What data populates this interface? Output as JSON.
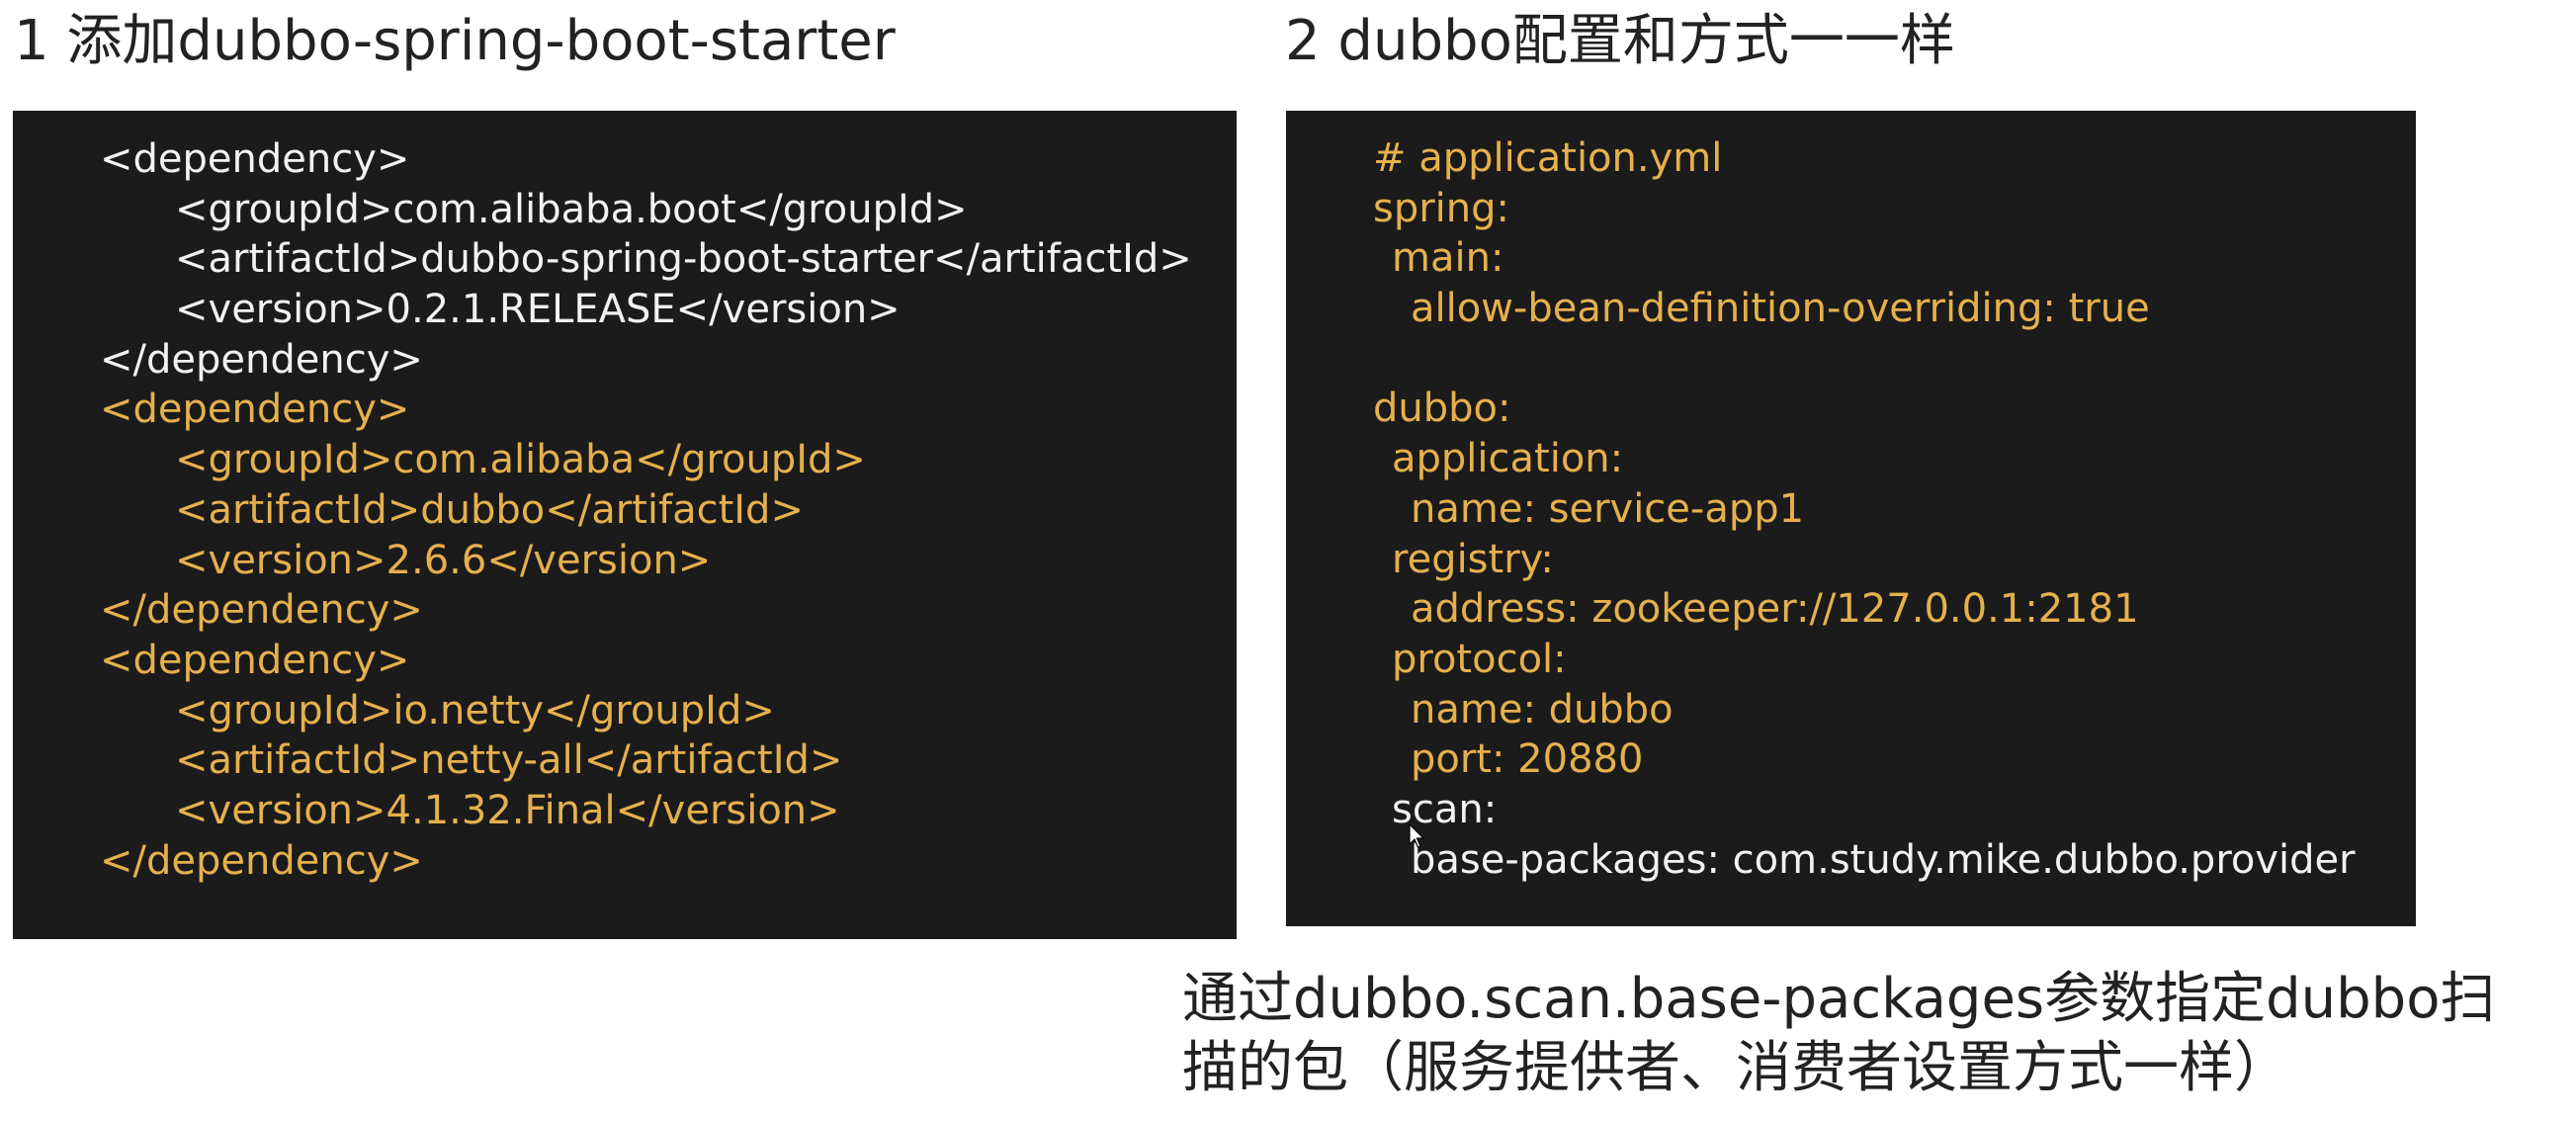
{
  "left_section": {
    "heading": "1 添加dubbo-spring-boot-starter",
    "code_lines": [
      {
        "text": "<dependency>",
        "indent": 0,
        "color": "#f2f2f2"
      },
      {
        "text": "<groupId>com.alibaba.boot</groupId>",
        "indent": 1,
        "color": "#f2f2f2"
      },
      {
        "text": "<artifactId>dubbo-spring-boot-starter</artifactId>",
        "indent": 1,
        "color": "#f2f2f2"
      },
      {
        "text": "<version>0.2.1.RELEASE</version>",
        "indent": 1,
        "color": "#f2f2f2"
      },
      {
        "text": "</dependency>",
        "indent": 0,
        "color": "#f2f2f2"
      },
      {
        "text": "<dependency>",
        "indent": 0,
        "color": "#e6b04d"
      },
      {
        "text": "<groupId>com.alibaba</groupId>",
        "indent": 1,
        "color": "#e6b04d"
      },
      {
        "text": "<artifactId>dubbo</artifactId>",
        "indent": 1,
        "color": "#e6b04d"
      },
      {
        "text": "<version>2.6.6</version>",
        "indent": 1,
        "color": "#e6b04d"
      },
      {
        "text": "</dependency>",
        "indent": 0,
        "color": "#e6b04d"
      },
      {
        "text": "<dependency>",
        "indent": 0,
        "color": "#e6b04d"
      },
      {
        "text": "<groupId>io.netty</groupId>",
        "indent": 1,
        "color": "#e6b04d"
      },
      {
        "text": "<artifactId>netty-all</artifactId>",
        "indent": 1,
        "color": "#e6b04d"
      },
      {
        "text": "<version>4.1.32.Final</version>",
        "indent": 1,
        "color": "#e6b04d"
      },
      {
        "text": "</dependency>",
        "indent": 0,
        "color": "#e6b04d"
      }
    ]
  },
  "right_section": {
    "heading": "2 dubbo配置和方式一一样",
    "code_lines": [
      {
        "text": "# application.yml",
        "indent": 0,
        "color": "#e6b04d"
      },
      {
        "text": "spring:",
        "indent": 0,
        "color": "#e6b04d"
      },
      {
        "text": "main:",
        "indent": 1,
        "color": "#e6b04d"
      },
      {
        "text": "allow-bean-definition-overriding: true",
        "indent": 2,
        "color": "#e6b04d"
      },
      {
        "text": "",
        "indent": 0,
        "color": "#e6b04d"
      },
      {
        "text": "dubbo:",
        "indent": 0,
        "color": "#e6b04d"
      },
      {
        "text": "application:",
        "indent": 1,
        "color": "#e6b04d"
      },
      {
        "text": "name: service-app1",
        "indent": 2,
        "color": "#e6b04d"
      },
      {
        "text": "registry:",
        "indent": 1,
        "color": "#e6b04d"
      },
      {
        "text": "address: zookeeper://127.0.0.1:2181",
        "indent": 2,
        "color": "#e6b04d"
      },
      {
        "text": "protocol:",
        "indent": 1,
        "color": "#e6b04d"
      },
      {
        "text": "name: dubbo",
        "indent": 2,
        "color": "#e6b04d"
      },
      {
        "text": "port: 20880",
        "indent": 2,
        "color": "#e6b04d"
      },
      {
        "text": "scan:",
        "indent": 1,
        "color": "#f2f2f2"
      },
      {
        "text": "base-packages: com.study.mike.dubbo.provider",
        "indent": 2,
        "color": "#f2f2f2"
      }
    ]
  },
  "note": {
    "lines": [
      "通过dubbo.scan.base-packages参数指定dubbo扫",
      "描的包（服务提供者、消费者设置方式一样）"
    ]
  },
  "colors": {
    "panel_background": "#1b1b1b",
    "code_white": "#f2f2f2",
    "code_gold": "#e6b04d",
    "page_background": "#ffffff"
  }
}
